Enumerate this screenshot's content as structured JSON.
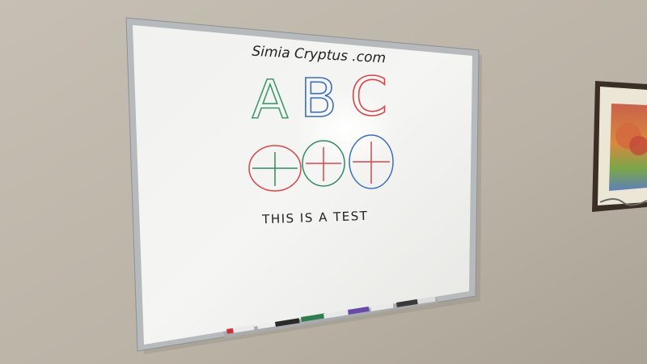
{
  "scene": {
    "description_label": "whiteboard-photo"
  },
  "whiteboard": {
    "header_text": "Simia Cryptus .com",
    "letters": [
      {
        "char": "A",
        "color": "#3f9a6a"
      },
      {
        "char": "B",
        "color": "#3c6fb8"
      },
      {
        "char": "C",
        "color": "#d9454a"
      }
    ],
    "circles": [
      {
        "ring_color": "#d9454a",
        "cross_color": "#2f8c62"
      },
      {
        "ring_color": "#2f8c62",
        "cross_color": "#d9454a"
      },
      {
        "ring_color": "#3c6fb8",
        "cross_color": "#d9454a"
      }
    ],
    "footer_text": "THIS IS A TEST"
  },
  "colors": {
    "wall": "#bdb6aa",
    "board": "#f3f3f1",
    "frame": "#b9bcbf",
    "marker_dark": "#222222"
  }
}
